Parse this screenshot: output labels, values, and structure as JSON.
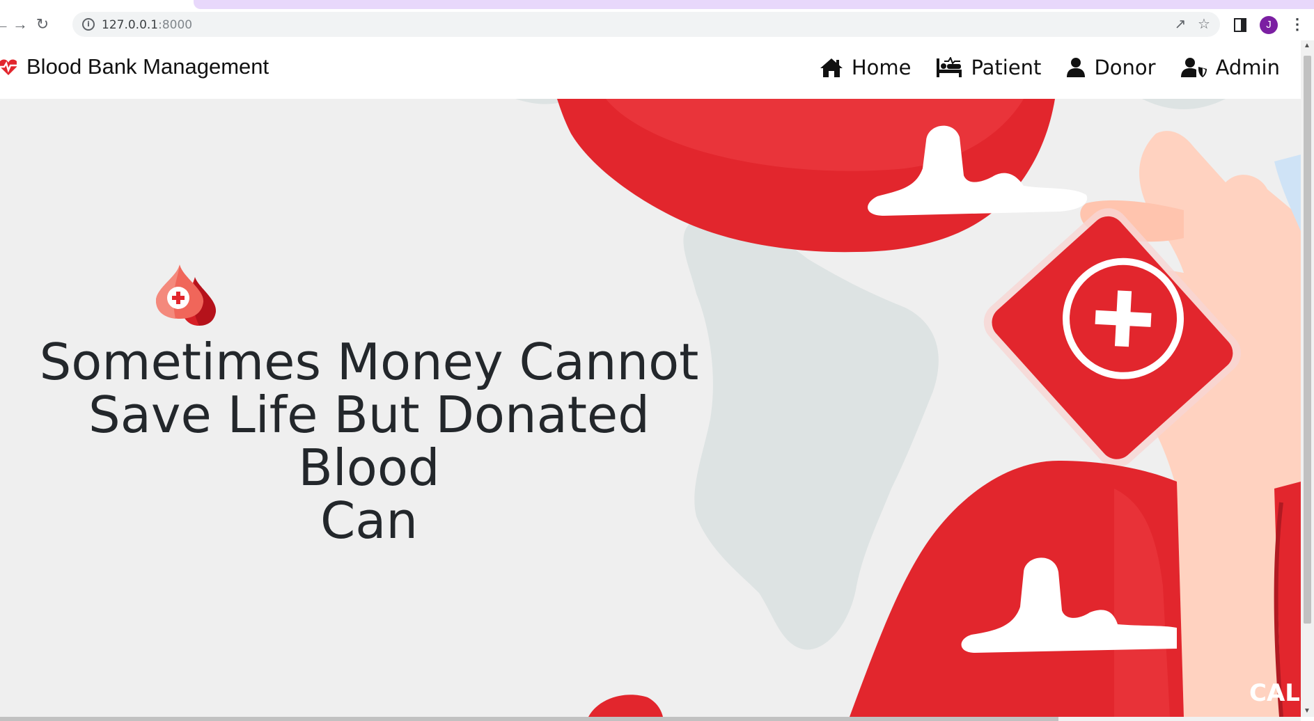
{
  "browser": {
    "url_host": "127.0.0.1",
    "url_port": ":8000",
    "profile_initial": "J",
    "icons": [
      "back-arrow-icon",
      "forward-arrow-icon",
      "reload-icon",
      "site-info-icon",
      "share-icon",
      "bookmark-star-icon",
      "side-panel-icon",
      "more-menu-icon"
    ]
  },
  "header": {
    "brand_title": "Blood Bank Management",
    "brand_icon": "heartbeat-icon",
    "nav": [
      {
        "label": "Home",
        "icon": "home-icon"
      },
      {
        "label": "Patient",
        "icon": "patient-bed-icon"
      },
      {
        "label": "Donor",
        "icon": "user-icon"
      },
      {
        "label": "Admin",
        "icon": "user-shield-icon"
      }
    ]
  },
  "hero": {
    "headline_lines": [
      "Sometimes Money Cannot",
      "Save Life But Donated Blood",
      "Can"
    ],
    "logo_icon": "blood-drops-icon",
    "corner_text": "CALL"
  },
  "colors": {
    "accent_red": "#e2262d",
    "hero_background": "#efefef",
    "headline_color": "#23272b",
    "tab_strip": "#e8d8fb"
  }
}
